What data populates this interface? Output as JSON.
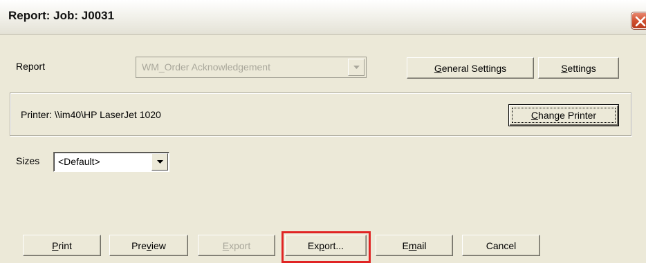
{
  "window": {
    "title": "Report: Job: J0031"
  },
  "report_row": {
    "label": "Report",
    "selected_report": "WM_Order Acknowledgement",
    "general_settings_label_accel": "G",
    "general_settings_label_rest": "eneral Settings",
    "settings_label_accel": "S",
    "settings_label_rest": "ettings"
  },
  "printer_group": {
    "printer_text": "Printer: \\\\im40\\HP LaserJet 1020",
    "change_printer_accel": "C",
    "change_printer_rest": "hange Printer"
  },
  "sizes_row": {
    "label": "Sizes",
    "selected_size": "<Default>"
  },
  "actions": {
    "print_accel": "P",
    "print_rest": "rint",
    "preview_pre": "Pre",
    "preview_accel": "v",
    "preview_post": "iew",
    "export_disabled_accel": "E",
    "export_disabled_rest": "xport",
    "export_dialog_pre": "Ex",
    "export_dialog_accel": "p",
    "export_dialog_post": "ort...",
    "email_pre": "E",
    "email_accel": "m",
    "email_post": "ail",
    "cancel": "Cancel"
  },
  "colors": {
    "dialog_bg": "#ece9d8",
    "disabled_text": "#a9a79b",
    "highlight_box": "#e02424",
    "close_button": "#d05030"
  },
  "icons": {
    "close": "close-x-icon",
    "dropdown": "chevron-down-icon"
  }
}
